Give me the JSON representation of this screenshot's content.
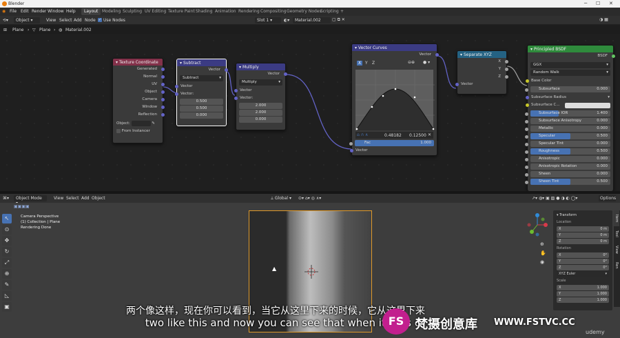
{
  "window": {
    "title": "Blender"
  },
  "menu": [
    "File",
    "Edit",
    "Render",
    "Window",
    "Help"
  ],
  "workspaces": [
    "Layout",
    "Modeling",
    "Sculpting",
    "UV Editing",
    "Texture Paint",
    "Shading",
    "Animation",
    "Rendering",
    "Compositing",
    "Geometry Nodes",
    "Scripting",
    "+"
  ],
  "nodehdr": {
    "mode": "Object",
    "items": [
      "View",
      "Select",
      "Add",
      "Node"
    ],
    "use_nodes": "Use Nodes",
    "slot": "Slot 1",
    "material": "Material.002"
  },
  "breadcrumb": [
    "Plane",
    "Plane",
    "Material.002"
  ],
  "texcoord": {
    "title": "Texture Coordinate",
    "outputs": [
      "Generated",
      "Normal",
      "UV",
      "Object",
      "Camera",
      "Window",
      "Reflection"
    ],
    "object_label": "Object:",
    "from_instancer": "From Instancer"
  },
  "subtract": {
    "title": "Subtract",
    "out": "Vector",
    "op": "Subtract",
    "in1": "Vector",
    "in2": "Vector:",
    "vals": [
      "0.500",
      "0.500",
      "0.000"
    ]
  },
  "multiply": {
    "title": "Multiply",
    "out": "Vector",
    "op": "Multiply",
    "in1": "Vector",
    "in2": "Vector:",
    "vals": [
      "2.000",
      "2.000",
      "0.000"
    ]
  },
  "curves": {
    "title": "Vector Curves",
    "out": "Vector",
    "tabs": [
      "X",
      "Y",
      "Z"
    ],
    "readout_x": "0.48182",
    "readout_y": "0.12500",
    "fac_label": "Fac",
    "fac_val": "1.000",
    "in": "Vector"
  },
  "separate": {
    "title": "Separate XYZ",
    "outputs": [
      "X",
      "Y",
      "Z"
    ],
    "in": "Vector"
  },
  "bsdf": {
    "title": "Principled BSDF",
    "out": "BSDF",
    "dist": "GGX",
    "sss_method": "Random Walk",
    "rows": [
      [
        "Base Color",
        ""
      ],
      [
        "Subsurface",
        "0.000"
      ],
      [
        "Subsurface Radius",
        ""
      ],
      [
        "Subsurface C...",
        ""
      ],
      [
        "Subsurface IOR",
        "1.400"
      ],
      [
        "Subsurface Anisotropy",
        "0.000"
      ],
      [
        "Metallic",
        "0.000"
      ],
      [
        "Specular",
        "0.500"
      ],
      [
        "Specular Tint",
        "0.000"
      ],
      [
        "Roughness",
        "0.500"
      ],
      [
        "Anisotropic",
        "0.000"
      ],
      [
        "Anisotropic Rotation",
        "0.000"
      ],
      [
        "Sheen",
        "0.000"
      ],
      [
        "Sheen Tint",
        "0.500"
      ]
    ],
    "fills": [
      0,
      0,
      0,
      0,
      0.35,
      0,
      0,
      0.5,
      0,
      0.5,
      0,
      0,
      0,
      0.5
    ]
  },
  "vphdr": {
    "mode": "Object Mode",
    "items": [
      "View",
      "Select",
      "Add",
      "Object"
    ],
    "orient": "Global",
    "options": "Options"
  },
  "overlay": [
    "Camera Perspective",
    "(1) Collection | Plane",
    "Rendering Done"
  ],
  "npanel": {
    "title": "Transform",
    "location": "Location",
    "rotation": "Rotation",
    "mode": "XYZ Euler",
    "scale": "Scale",
    "loc": [
      [
        "X",
        "0 m"
      ],
      [
        "Y",
        "0 m"
      ],
      [
        "Z",
        "0 m"
      ]
    ],
    "rot": [
      [
        "X",
        "0°"
      ],
      [
        "Y",
        "0°"
      ],
      [
        "Z",
        "0°"
      ]
    ],
    "scl": [
      [
        "X",
        "1.000"
      ],
      [
        "Y",
        "1.000"
      ],
      [
        "Z",
        "1.000"
      ]
    ]
  },
  "sidetabs": [
    "Item",
    "Tool",
    "View",
    "Ren"
  ],
  "subs": {
    "cn": "两个像这样，现在你可以看到，当它从这里下来的时候，它从这里下来",
    "en": "two like this and now you can see that when it gets c"
  },
  "logo": {
    "mark": "FS",
    "cn": "梵摄创意库",
    "url": "WWW.FSTVC.CC",
    "udemy": "udemy"
  },
  "colors": {
    "texcoord": "#83314a",
    "vector": "#3b3b83",
    "separate": "#246283",
    "shader": "#2f8b3c",
    "socket_vec": "#6363c7",
    "socket_float": "#a1a1a1",
    "socket_col": "#c7c729",
    "accent": "#4772b3"
  }
}
